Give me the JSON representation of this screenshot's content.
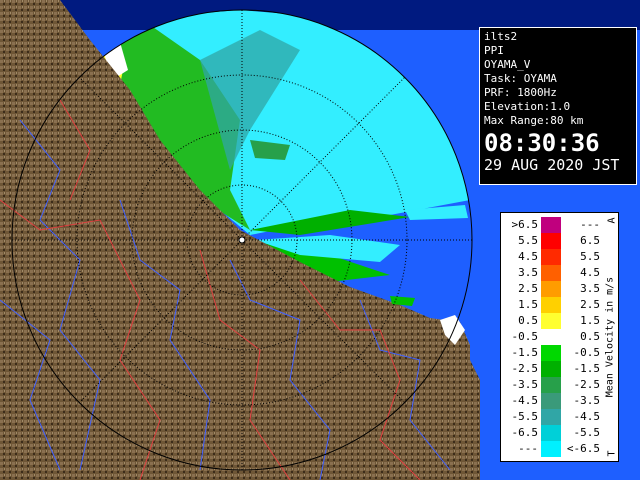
{
  "info": {
    "product": "ilts2",
    "scan_type": "PPI",
    "site": "OYAMA_V",
    "task": "Task: OYAMA",
    "prf": "PRF: 1800Hz",
    "elevation": "Elevation:1.0",
    "max_range": "Max Range:80 km",
    "time": "08:30:36",
    "date": "29 AUG 2020 JST"
  },
  "legend": {
    "title": "Mean Velocity in m/s",
    "tag_top": "A",
    "tag_bottom": "T",
    "rows": [
      {
        "lo": ">6.5",
        "hi": "---",
        "color": "#c0007e"
      },
      {
        "lo": "5.5",
        "hi": "6.5",
        "color": "#ff0000"
      },
      {
        "lo": "4.5",
        "hi": "5.5",
        "color": "#ff2a00"
      },
      {
        "lo": "3.5",
        "hi": "4.5",
        "color": "#ff6000"
      },
      {
        "lo": "2.5",
        "hi": "3.5",
        "color": "#ff9c00"
      },
      {
        "lo": "1.5",
        "hi": "2.5",
        "color": "#ffd000"
      },
      {
        "lo": "0.5",
        "hi": "1.5",
        "color": "#ffff30"
      },
      {
        "lo": "-0.5",
        "hi": "0.5",
        "color": "#ffffff"
      },
      {
        "lo": "-1.5",
        "hi": "-0.5",
        "color": "#00d800"
      },
      {
        "lo": "-2.5",
        "hi": "-1.5",
        "color": "#00b000"
      },
      {
        "lo": "-3.5",
        "hi": "-2.5",
        "color": "#27a04a"
      },
      {
        "lo": "-4.5",
        "hi": "-3.5",
        "color": "#3a9a7a"
      },
      {
        "lo": "-5.5",
        "hi": "-4.5",
        "color": "#30a6a6"
      },
      {
        "lo": "-6.5",
        "hi": "-5.5",
        "color": "#00d0d8"
      },
      {
        "lo": "---",
        "hi": "<-6.5",
        "color": "#00f0ff"
      }
    ]
  },
  "colors": {
    "sea": "#1e5fff",
    "land": "#7a5e3c",
    "echo_cyan": "#33eeff",
    "echo_green": "#22bb22",
    "echo_blue": "#2266ff"
  }
}
